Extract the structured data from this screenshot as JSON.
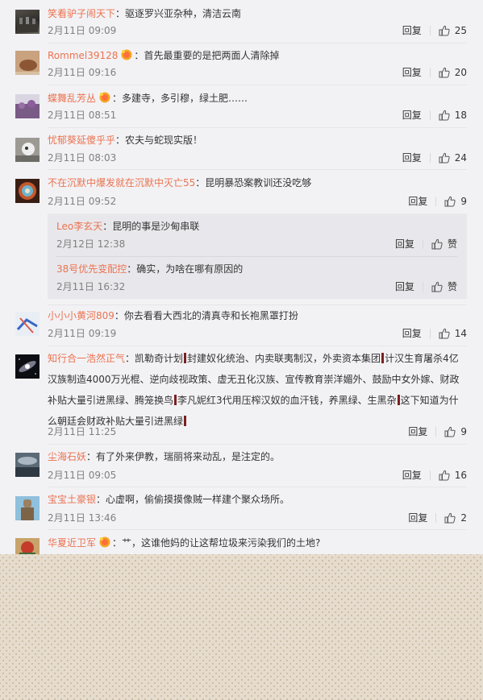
{
  "like_text": "赞",
  "reply_text": "回复",
  "comments": [
    {
      "user": "笑看驴子闹天下",
      "text": "驱逐罗兴亚杂种，清洁云南",
      "time": "2月11日 09:09",
      "likes": "25"
    },
    {
      "user": "Rommel39128",
      "text": "首先最重要的是把两面人清除掉",
      "time": "2月11日 09:16",
      "likes": "20"
    },
    {
      "user": "蝶舞乱芳丛",
      "text": "多建寺，多引穆，绿土肥……",
      "time": "2月11日 08:51",
      "likes": "18"
    },
    {
      "user": "忧郁葵延傻乎乎",
      "text": "农夫与蛇现实版！",
      "time": "2月11日 08:03",
      "likes": "24"
    },
    {
      "user": "不在沉默中爆发就在沉默中灭亡55",
      "text": "昆明暴恐案教训还没吃够",
      "time": "2月11日 09:52",
      "likes": "9"
    },
    {
      "user": "小小小黄河809",
      "text": "你去看看大西北的清真寺和长袍黑罩打扮",
      "time": "2月11日 09:19",
      "likes": "14"
    },
    {
      "user": "知行合一浩然正气",
      "text_parts": [
        "凯勒奇计划",
        "封建奴化统治、内卖联夷制汉，外卖资本集团",
        "计汉生育屠杀4亿汉族制造4000万光棍、逆向歧视政策、虚无丑化汉族、宣传教育崇洋媚外、鼓励中女外嫁、财政补贴大量引进黑绿、腾笼换鸟",
        "李凡妮红3代用压榨汉奴的血汗钱，养黑绿、生黑杂",
        "这下知道为什么朝廷会财政补贴大量引进黑绿"
      ],
      "time": "2月11日 11:25",
      "likes": "9"
    },
    {
      "user": "尘海石妖",
      "text": "有了外来伊教，瑞丽将来动乱，是注定的。",
      "time": "2月11日 09:05",
      "likes": "16"
    },
    {
      "user": "宝宝土豪银",
      "text": "心虚啊，偷偷摸摸像贼一样建个聚众场所。",
      "time": "2月11日 13:46",
      "likes": "2"
    },
    {
      "user": "华夏近卫军",
      "text": "艹，这谁他妈的让这帮垃圾来污染我们的土地?"
    }
  ],
  "replies": [
    {
      "user": "Leo李玄天",
      "text": "昆明的事是沙甸串联",
      "time": "2月12日 12:38"
    },
    {
      "user": "38号优先变配控",
      "text": "确实，为啥在哪有原因的",
      "time": "2月11日 16:32"
    }
  ],
  "colors": {
    "username": "#eb7350",
    "background": "#f2f2f5",
    "reply_box": "#e8e8ec",
    "mark": "#7a2020"
  }
}
